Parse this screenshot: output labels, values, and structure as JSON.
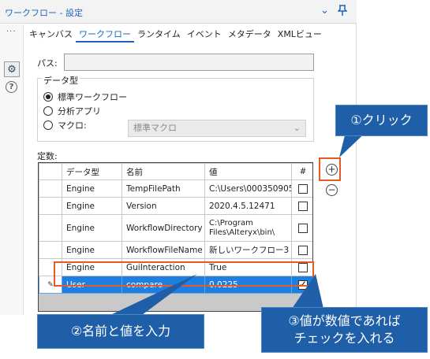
{
  "window": {
    "title": "ワークフロー - 設定",
    "collapse_icon": "chevron-down-icon",
    "pin_icon": "pin-icon"
  },
  "rail": {
    "more_label": "...",
    "settings_icon": "gear-icon",
    "help_icon": "help-icon",
    "help_glyph": "?"
  },
  "tabs": [
    "キャンバス",
    "ワークフロー",
    "ランタイム",
    "イベント",
    "メタデータ",
    "XMLビュー"
  ],
  "active_tab": "ワークフロー",
  "form": {
    "path_label": "パス:",
    "path_value": "",
    "workflow_type_label": "データ型",
    "options": [
      "標準ワークフロー",
      "分析アプリ",
      "マクロ:"
    ],
    "selected_option": "標準ワークフロー",
    "macro_select_value": "標準マクロ"
  },
  "constants": {
    "label": "定数:",
    "columns": [
      "データ型",
      "名前",
      "値",
      "#"
    ],
    "rows": [
      {
        "type": "Engine",
        "name": "TempFilePath",
        "value": "C:\\Users\\000350905\\",
        "checked": false
      },
      {
        "type": "Engine",
        "name": "Version",
        "value": "2020.4.5.12471",
        "checked": false
      },
      {
        "type": "Engine",
        "name": "WorkflowDirectory",
        "value": "C:\\Program Files\\Alteryx\\bin\\",
        "checked": false
      },
      {
        "type": "Engine",
        "name": "WorkflowFileName",
        "value": "新しいワークフロー3",
        "checked": false
      },
      {
        "type": "Engine",
        "name": "GuiInteraction",
        "value": "True",
        "checked": false
      },
      {
        "type": "User",
        "name": "compare",
        "value": "0.0225",
        "checked": true
      }
    ],
    "editing_row_indicator": "✎"
  },
  "side_buttons": {
    "add_glyph": "+",
    "remove_glyph": "−"
  },
  "annotations": {
    "callout1": "①クリック",
    "callout2": "②名前と値を入力",
    "callout3_line1": "③値が数値であれば",
    "callout3_line2": "チェックを入れる",
    "colors": {
      "red_box": "#e85a24",
      "callout_bg": "#1f5fa8",
      "selection": "#1e7fe0"
    }
  }
}
